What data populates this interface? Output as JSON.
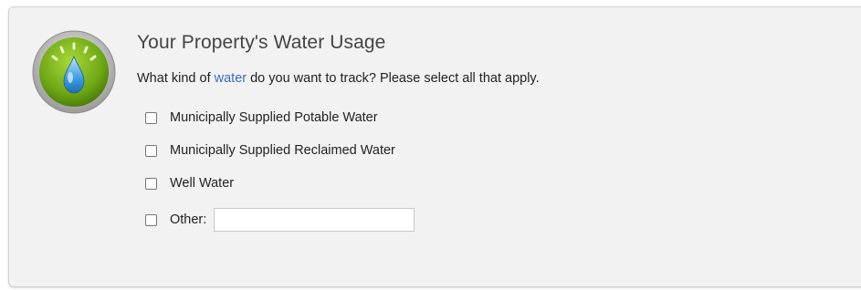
{
  "panel": {
    "title": "Your Property's Water Usage",
    "question_before": "What kind of ",
    "question_link": "water",
    "question_after": " do you want to track? Please select all that apply.",
    "icon": "water-drop-gauge-icon"
  },
  "options": [
    {
      "label": "Municipally Supplied Potable Water",
      "checked": false
    },
    {
      "label": "Municipally Supplied Reclaimed Water",
      "checked": false
    },
    {
      "label": "Well Water",
      "checked": false
    },
    {
      "label": "Other:",
      "checked": false
    }
  ],
  "other_input": {
    "value": "",
    "placeholder": ""
  },
  "colors": {
    "panel_bg": "#f2f2f2",
    "link": "#3a6cc0",
    "icon_green": "#7cb518",
    "drop_blue": "#2f8fd8"
  }
}
